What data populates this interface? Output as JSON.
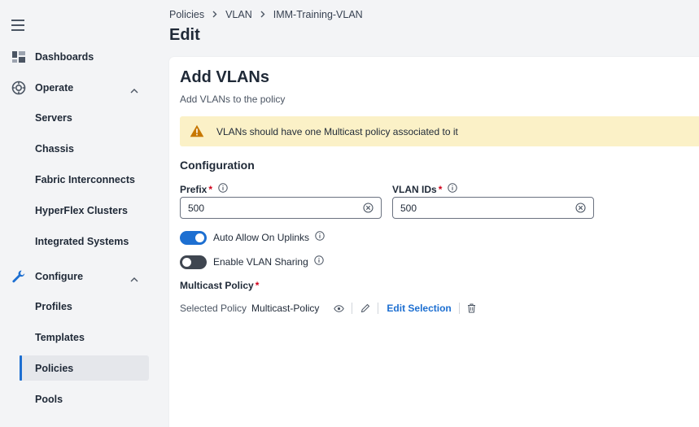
{
  "sidebar": {
    "items": [
      {
        "label": "Dashboards",
        "icon": "dashboard-icon"
      },
      {
        "label": "Operate",
        "icon": "operate-icon",
        "expanded": true
      },
      {
        "label": "Servers"
      },
      {
        "label": "Chassis"
      },
      {
        "label": "Fabric Interconnects"
      },
      {
        "label": "HyperFlex Clusters"
      },
      {
        "label": "Integrated Systems"
      },
      {
        "label": "Configure",
        "icon": "wrench-icon",
        "expanded": true
      },
      {
        "label": "Profiles"
      },
      {
        "label": "Templates"
      },
      {
        "label": "Policies",
        "active": true
      },
      {
        "label": "Pools"
      }
    ]
  },
  "breadcrumb": [
    "Policies",
    "VLAN",
    "IMM-Training-VLAN"
  ],
  "page_title": "Edit",
  "panel": {
    "title": "Add VLANs",
    "subtitle": "Add VLANs to the policy",
    "alert": "VLANs should have one Multicast policy associated to it",
    "section_title": "Configuration",
    "prefix": {
      "label": "Prefix",
      "required": "*",
      "value": "500"
    },
    "vlan_ids": {
      "label": "VLAN IDs",
      "required": "*",
      "value": "500"
    },
    "auto_allow": {
      "label": "Auto Allow On Uplinks",
      "on": true
    },
    "vlan_sharing": {
      "label": "Enable VLAN Sharing",
      "on": false
    },
    "multicast": {
      "label": "Multicast Policy",
      "required": "*",
      "selected_label": "Selected Policy",
      "selected_value": "Multicast-Policy",
      "edit_label": "Edit Selection"
    }
  },
  "colors": {
    "accent": "#1d6fd1",
    "warning_bg": "#fbf1c7",
    "warning_icon": "#c77800",
    "required": "#d0021b"
  }
}
